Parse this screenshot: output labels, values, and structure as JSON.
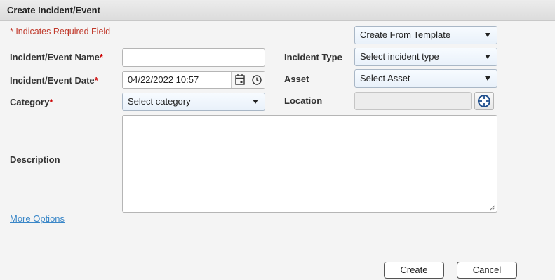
{
  "dialog": {
    "title": "Create Incident/Event"
  },
  "required_note": "* Indicates Required Field",
  "template_select": {
    "value": "Create From Template"
  },
  "fields": {
    "name_label": "Incident/Event Name",
    "date_label": "Incident/Event Date",
    "category_label": "Category",
    "incident_type_label": "Incident Type",
    "asset_label": "Asset",
    "location_label": "Location",
    "description_label": "Description",
    "required_star": "*"
  },
  "values": {
    "name": "",
    "date": "04/22/2022 10:57",
    "category": "Select category",
    "incident_type": "Select incident type",
    "asset": "Select Asset",
    "location": "",
    "description": ""
  },
  "more_options": "More Options",
  "buttons": {
    "create": "Create",
    "cancel": "Cancel"
  },
  "colors": {
    "required": "#c0392b",
    "link": "#3a87c8",
    "select_bg": "#e9f1fa",
    "locate_icon": "#1f4e8c"
  },
  "icons": [
    "calendar-icon",
    "clock-icon",
    "crosshair-icon",
    "chevron-down-icon",
    "resize-grip-icon"
  ]
}
